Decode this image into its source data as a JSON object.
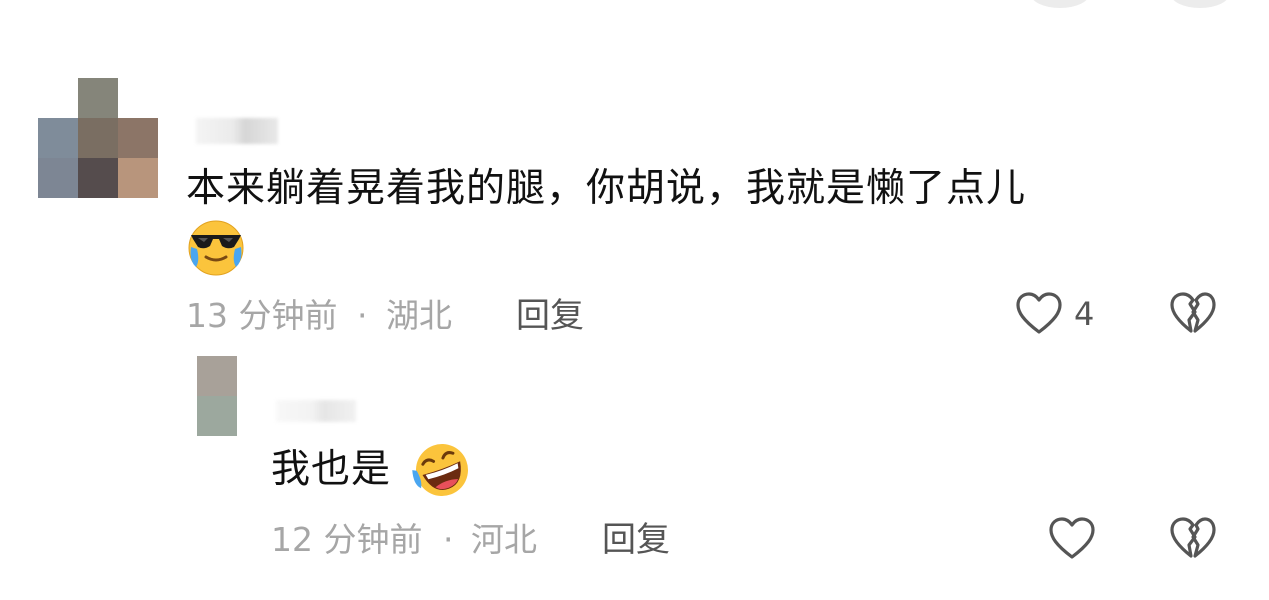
{
  "comments": [
    {
      "text": "本来躺着晃着我的腿，你胡说，我就是懒了点儿",
      "emoji": "cool-face-crying-emoji",
      "time": "13 分钟前",
      "separator": "·",
      "location": "湖北",
      "reply_label": "回复",
      "like_count": "4"
    },
    {
      "text": "我也是",
      "emoji": "rofl-emoji",
      "time": "12 分钟前",
      "separator": "·",
      "location": "河北",
      "reply_label": "回复"
    }
  ],
  "colors": {
    "text": "#111111",
    "meta": "#a6a6a6",
    "icon": "#555555"
  }
}
